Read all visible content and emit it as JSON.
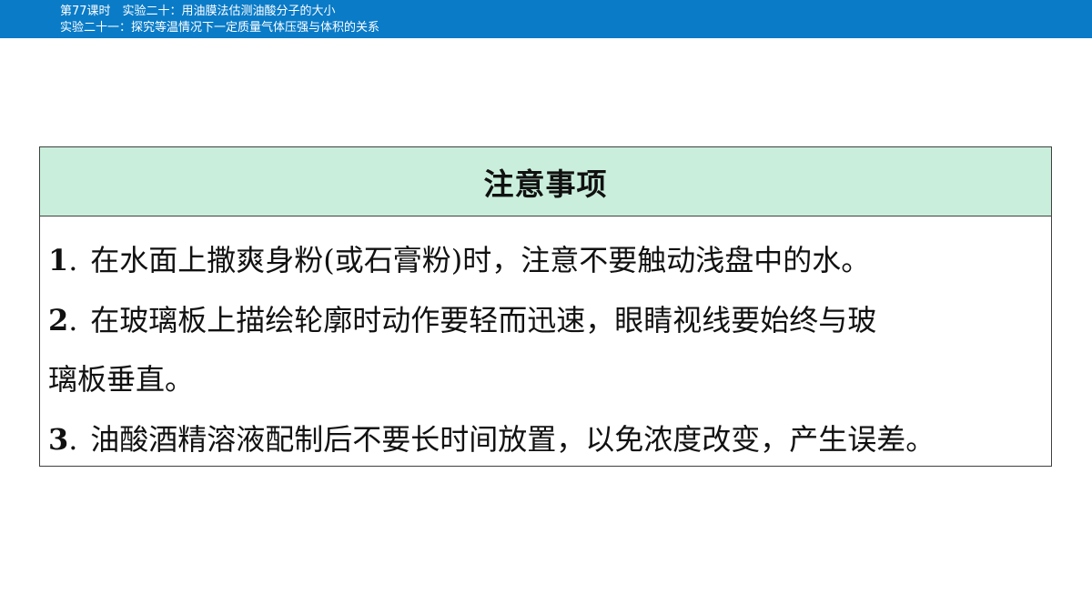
{
  "header": {
    "line1": "第77课时　实验二十：用油膜法估测油酸分子的大小",
    "line2": "实验二十一：探究等温情况下一定质量气体压强与体积的关系"
  },
  "notes": {
    "title": "注意事项",
    "items": [
      {
        "num": "1",
        "dot": ".",
        "text": "在水面上撒爽身粉(或石膏粉)时，注意不要触动浅盘中的水。"
      },
      {
        "num": "2",
        "dot": ".",
        "text": "在玻璃板上描绘轮廓时动作要轻而迅速，眼睛视线要始终与玻",
        "cont": "璃板垂直。"
      },
      {
        "num": "3",
        "dot": ".",
        "text": "油酸酒精溶液配制后不要长时间放置，以免浓度改变，产生误差。"
      }
    ]
  },
  "colors": {
    "header_bg": "#0a7bc7",
    "table_head_bg": "#c9efdc",
    "border": "#404040"
  }
}
